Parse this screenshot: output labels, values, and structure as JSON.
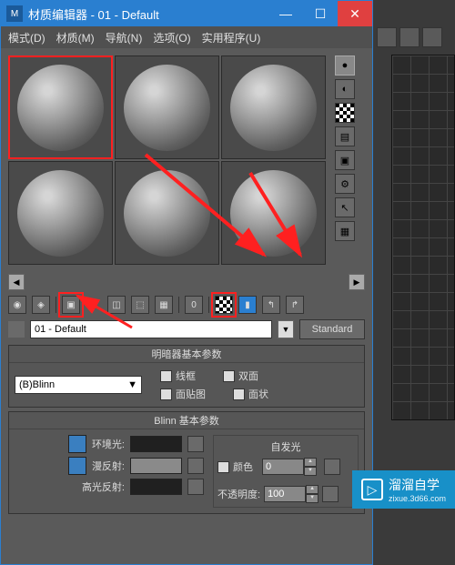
{
  "window": {
    "title": "材质编辑器 - 01 - Default"
  },
  "menu": {
    "mode": "模式(D)",
    "material": "材质(M)",
    "navigate": "导航(N)",
    "options": "选项(O)",
    "utilities": "实用程序(U)"
  },
  "material_name": "01 - Default",
  "standard_btn": "Standard",
  "rollout1": {
    "title": "明暗器基本参数",
    "shader": "(B)Blinn",
    "wire": "线框",
    "two_sided": "双面",
    "face_map": "面贴图",
    "faceted": "面状"
  },
  "rollout2": {
    "title": "Blinn 基本参数",
    "ambient": "环境光:",
    "diffuse": "漫反射:",
    "specular": "高光反射:",
    "self_illum": "自发光",
    "color": "颜色",
    "color_val": "0",
    "opacity": "不透明度:",
    "opacity_val": "100"
  },
  "watermark": {
    "text": "溜溜自学",
    "sub": "zixue.3d66.com"
  },
  "icons": {
    "sample_type": "●",
    "backlight": "◐",
    "background": "▦",
    "uv": "▤",
    "video": "▣",
    "options": "⚙",
    "select": "↖",
    "checker": "▦"
  }
}
